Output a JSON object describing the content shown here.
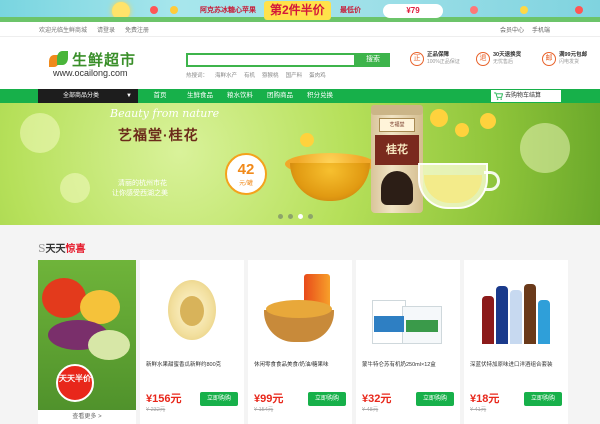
{
  "promo": {
    "title": "第2件半价",
    "left_text": "阿克苏冰糖心苹果",
    "right_text": "最低价",
    "price": "¥79"
  },
  "topbar": {
    "links": [
      "欢迎光临生鲜商城",
      "请登录",
      "免费注册"
    ],
    "right": [
      "会员中心",
      "手机端"
    ]
  },
  "logo": {
    "name": "生鲜超市",
    "site": "www.ocailong.com"
  },
  "search": {
    "placeholder": "",
    "button": "搜索",
    "hot": [
      "热搜词：",
      "海鲜水产",
      "有机",
      "猕猴桃",
      "国产料",
      "蛋肉鸡"
    ]
  },
  "badges": [
    {
      "icon": "正",
      "title": "正品保障",
      "sub": "100%正品保证"
    },
    {
      "icon": "退",
      "title": "30天退换货",
      "sub": "无忧售后"
    },
    {
      "icon": "邮",
      "title": "满99元包邮",
      "sub": "闪电发货"
    }
  ],
  "nav": {
    "all": "全部商品分类",
    "items": [
      "首页",
      "生鲜食品",
      "粮水饮料",
      "团购商品",
      "积分兑换"
    ],
    "cart": "去购物车结算"
  },
  "banner": {
    "script": "Beauty from nature",
    "title": "艺福堂·桂花",
    "price": "42",
    "unit": "元/罐",
    "sub1": "清丽的杭州市花",
    "sub2": "让你感受西湖之美",
    "can_label": "桂花",
    "can_brand": "艺福堂"
  },
  "section": {
    "s": "S",
    "t1": "天天",
    "t2": "惊喜",
    "left_stamp": "天天半价",
    "left_more": "查看更多 >"
  },
  "products": [
    {
      "name": "新鲜水果甜蜜香瓜新鲜约800克",
      "price": "¥156元",
      "old": "¥ 232元",
      "buy": "立即购购"
    },
    {
      "name": "休闲零食食品美食/奶油/糖果味",
      "price": "¥99元",
      "old": "¥ 154元",
      "buy": "立即购购"
    },
    {
      "name": "蒙牛特仑苏有机奶250ml×12盒",
      "price": "¥32元",
      "old": "¥ 48元",
      "buy": "立即购购"
    },
    {
      "name": "深蓝伏特加原味进口洋酒组合套装",
      "price": "¥18元",
      "old": "¥ 41元",
      "buy": "立即购购"
    }
  ],
  "colors": {
    "green": "#17b04a",
    "red": "#e8271b",
    "orange": "#f18a1a"
  }
}
